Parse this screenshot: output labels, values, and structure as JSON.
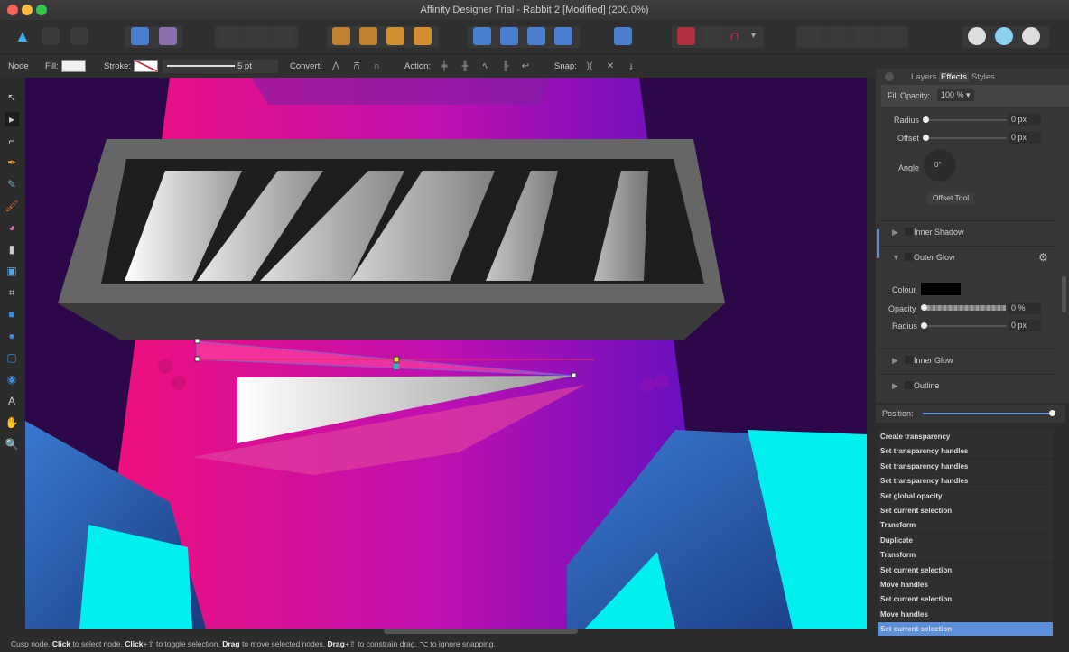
{
  "window": {
    "title": "Affinity Designer Trial - Rabbit 2 [Modified] (200.0%)"
  },
  "context": {
    "mode": "Node",
    "fill_label": "Fill:",
    "stroke_label": "Stroke:",
    "stroke_width": "5 pt",
    "convert_label": "Convert:",
    "action_label": "Action:",
    "snap_label": "Snap:",
    "fill_color": "#f0f0f0"
  },
  "panel": {
    "tabs": [
      "Layers",
      "Effects",
      "Styles"
    ],
    "active_tab": "Effects",
    "fill_opacity_label": "Fill Opacity:",
    "fill_opacity": "100 %",
    "radius_label": "Radius",
    "radius": "0 px",
    "offset_label": "Offset",
    "offset": "0 px",
    "angle_label": "Angle",
    "angle": "0°",
    "offset_tool": "Offset Tool",
    "sections": [
      "Inner Shadow",
      "Outer Glow",
      "Inner Glow",
      "Outline"
    ],
    "glow": {
      "colour_label": "Colour",
      "colour": "#000000",
      "opacity_label": "Opacity",
      "opacity": "0 %",
      "radius_label": "Radius",
      "radius": "0 px"
    }
  },
  "history": {
    "position_label": "Position:",
    "position": 1.0,
    "items": [
      "Create transparency",
      "Set transparency handles",
      "Set transparency handles",
      "Set transparency handles",
      "Set global opacity",
      "Set current selection",
      "Transform",
      "Duplicate",
      "Transform",
      "Set current selection",
      "Move handles",
      "Set current selection",
      "Move handles",
      "Set current selection"
    ],
    "selected_index": 13
  },
  "status": {
    "p1": "Cusp node. ",
    "b1": "Click",
    "p2": " to select node. ",
    "b2": "Click",
    "p3": "+⇧ to toggle selection. ",
    "b3": "Drag",
    "p4": " to move selected nodes. ",
    "b4": "Drag",
    "p5": "+⇧ to constrain drag. ⌥ to ignore snapping."
  },
  "colors": {
    "accent": "#5b8fd9",
    "canvas_bg": "#3a0a5a",
    "cyan": "#00f0f0",
    "magenta": "#e0107a"
  }
}
